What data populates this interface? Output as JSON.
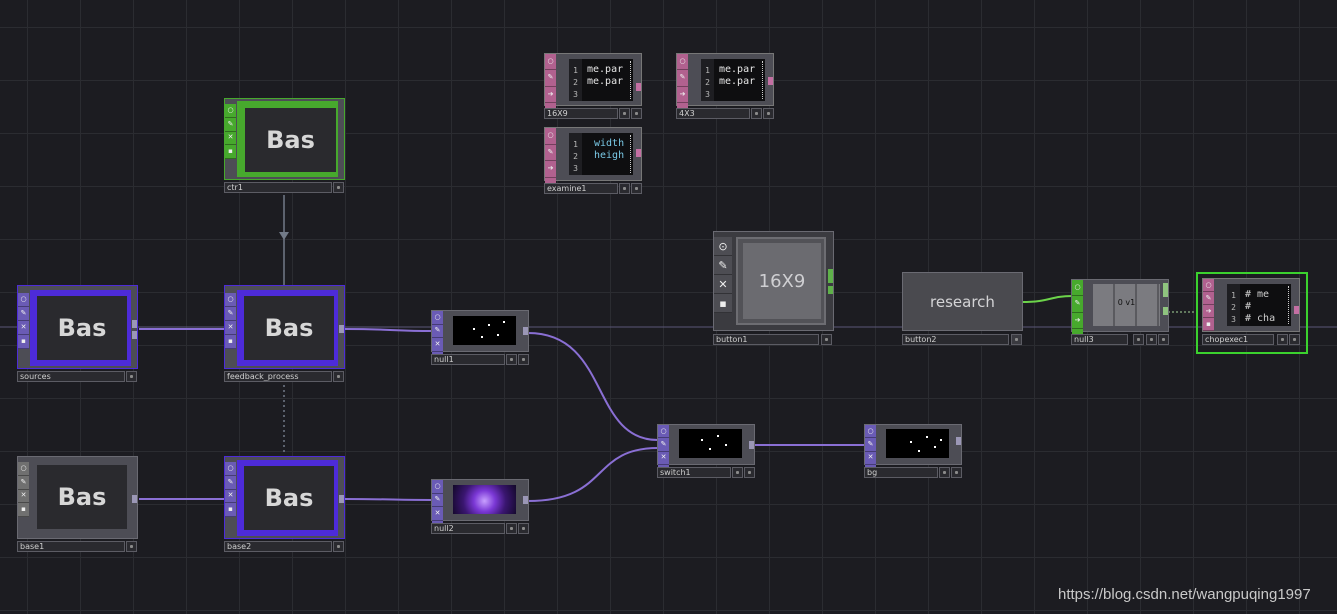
{
  "colors": {
    "background": "#1c1c21",
    "base_comp": "#4d2bd9",
    "panel_comp": "#47a92d",
    "dat": "#b1618f",
    "top": "#6a5bb5",
    "wire": "#8a6fd4",
    "green_wire": "#6cd34a",
    "selected": "#3bd12e"
  },
  "base_nodes": {
    "ctr1": {
      "name": "ctr1",
      "label": "Bas"
    },
    "sources": {
      "name": "sources",
      "label": "Bas"
    },
    "feedback": {
      "name": "feedback_process",
      "label": "Bas"
    },
    "base1": {
      "name": "base1",
      "label": "Bas"
    },
    "base2": {
      "name": "base2",
      "label": "Bas"
    }
  },
  "top_nodes": {
    "null1": {
      "name": "null1"
    },
    "null2": {
      "name": "null2"
    },
    "switch1": {
      "name": "switch1"
    },
    "bg": {
      "name": "bg"
    }
  },
  "dat_nodes": {
    "t16x9": {
      "name": "16X9",
      "lines": [
        "1",
        "2",
        "3"
      ],
      "code": [
        "me.par",
        "me.par"
      ]
    },
    "t4x3": {
      "name": "4X3",
      "lines": [
        "1",
        "2",
        "3"
      ],
      "code": [
        "me.par",
        "me.par"
      ]
    },
    "examine1": {
      "name": "examine1",
      "lines": [
        "1",
        "2",
        "3"
      ],
      "code": [
        "width",
        "heigh"
      ]
    },
    "chopexec1": {
      "name": "chopexec1",
      "lines": [
        "1",
        "2",
        "3"
      ],
      "code": [
        "# me",
        "#",
        "# cha"
      ]
    }
  },
  "panel_nodes": {
    "button1": {
      "name": "button1",
      "label": "16X9"
    },
    "button2": {
      "name": "button2",
      "label": "research"
    }
  },
  "chop_nodes": {
    "null3": {
      "name": "null3",
      "value": "0 v1"
    }
  },
  "icons": {
    "viewer_toggle": "circle-icon",
    "edit": "pencil-icon",
    "bypass": "x-icon",
    "lock": "lock-icon",
    "export": "arrow-icon"
  },
  "watermark": "https://blog.csdn.net/wangpuqing1997"
}
